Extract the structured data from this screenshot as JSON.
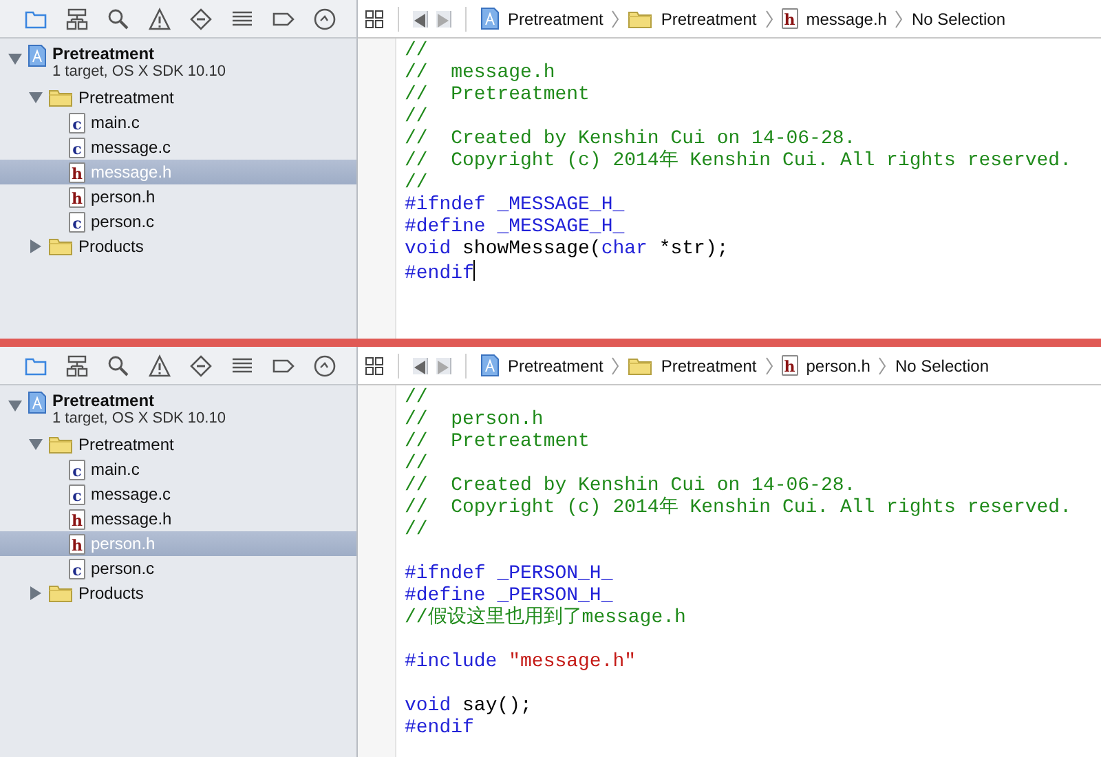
{
  "panes": [
    {
      "navigator_tabs": [
        {
          "kind": "folder",
          "selected": true
        },
        {
          "kind": "hierarchy",
          "selected": false
        },
        {
          "kind": "search",
          "selected": false
        },
        {
          "kind": "warning",
          "selected": false
        },
        {
          "kind": "breakpoint",
          "selected": false
        },
        {
          "kind": "list",
          "selected": false
        },
        {
          "kind": "tag",
          "selected": false
        },
        {
          "kind": "clock",
          "selected": false
        }
      ],
      "navigator": {
        "name": "Pretreatment",
        "subtitle": "1 target, OS X SDK 10.10",
        "expanded": true,
        "selected": false,
        "children": [
          {
            "kind": "folder",
            "name": "Pretreatment",
            "expanded": true,
            "selected": false,
            "children": [
              {
                "kind": "source",
                "badge": "c",
                "name": "main.c",
                "selected": false
              },
              {
                "kind": "source",
                "badge": "c",
                "name": "message.c",
                "selected": false
              },
              {
                "kind": "header",
                "badge": "h",
                "name": "message.h",
                "selected": true
              },
              {
                "kind": "header",
                "badge": "h",
                "name": "person.h",
                "selected": false
              },
              {
                "kind": "source",
                "badge": "c",
                "name": "person.c",
                "selected": false
              }
            ]
          },
          {
            "kind": "folder",
            "name": "Products",
            "expanded": false,
            "selected": false
          }
        ]
      },
      "jump_bar": [
        {
          "kind": "project",
          "label": "Pretreatment"
        },
        {
          "kind": "folder",
          "label": "Pretreatment"
        },
        {
          "kind": "header",
          "badge": "h",
          "label": "message.h"
        },
        {
          "kind": "plain",
          "label": "No Selection"
        }
      ],
      "code": [
        {
          "cursor": false,
          "tokens": [
            {
              "kind": "comment",
              "text": "//"
            }
          ]
        },
        {
          "cursor": false,
          "tokens": [
            {
              "kind": "comment",
              "text": "//  message.h"
            }
          ]
        },
        {
          "cursor": false,
          "tokens": [
            {
              "kind": "comment",
              "text": "//  Pretreatment"
            }
          ]
        },
        {
          "cursor": false,
          "tokens": [
            {
              "kind": "comment",
              "text": "//"
            }
          ]
        },
        {
          "cursor": false,
          "tokens": [
            {
              "kind": "comment",
              "text": "//  Created by Kenshin Cui on 14-06-28."
            }
          ]
        },
        {
          "cursor": false,
          "tokens": [
            {
              "kind": "comment",
              "text": "//  Copyright (c) 2014年 Kenshin Cui. All rights reserved."
            }
          ]
        },
        {
          "cursor": false,
          "tokens": [
            {
              "kind": "comment",
              "text": "//"
            }
          ]
        },
        {
          "cursor": false,
          "tokens": [
            {
              "kind": "keyword",
              "text": "#ifndef _MESSAGE_H_"
            }
          ]
        },
        {
          "cursor": false,
          "tokens": [
            {
              "kind": "keyword",
              "text": "#define _MESSAGE_H_"
            }
          ]
        },
        {
          "cursor": false,
          "tokens": [
            {
              "kind": "keyword",
              "text": "void"
            },
            {
              "kind": "plain",
              "text": " showMessage("
            },
            {
              "kind": "keyword",
              "text": "char"
            },
            {
              "kind": "plain",
              "text": " *str);"
            }
          ]
        },
        {
          "cursor": true,
          "tokens": [
            {
              "kind": "keyword",
              "text": "#endif"
            }
          ]
        }
      ]
    },
    {
      "navigator_tabs": [
        {
          "kind": "folder",
          "selected": true
        },
        {
          "kind": "hierarchy",
          "selected": false
        },
        {
          "kind": "search",
          "selected": false
        },
        {
          "kind": "warning",
          "selected": false
        },
        {
          "kind": "breakpoint",
          "selected": false
        },
        {
          "kind": "list",
          "selected": false
        },
        {
          "kind": "tag",
          "selected": false
        },
        {
          "kind": "clock",
          "selected": false
        }
      ],
      "navigator": {
        "name": "Pretreatment",
        "subtitle": "1 target, OS X SDK 10.10",
        "expanded": true,
        "selected": false,
        "children": [
          {
            "kind": "folder",
            "name": "Pretreatment",
            "expanded": true,
            "selected": false,
            "children": [
              {
                "kind": "source",
                "badge": "c",
                "name": "main.c",
                "selected": false
              },
              {
                "kind": "source",
                "badge": "c",
                "name": "message.c",
                "selected": false
              },
              {
                "kind": "header",
                "badge": "h",
                "name": "message.h",
                "selected": false
              },
              {
                "kind": "header",
                "badge": "h",
                "name": "person.h",
                "selected": true
              },
              {
                "kind": "source",
                "badge": "c",
                "name": "person.c",
                "selected": false
              }
            ]
          },
          {
            "kind": "folder",
            "name": "Products",
            "expanded": false,
            "selected": false
          }
        ]
      },
      "jump_bar": [
        {
          "kind": "project",
          "label": "Pretreatment"
        },
        {
          "kind": "folder",
          "label": "Pretreatment"
        },
        {
          "kind": "header",
          "badge": "h",
          "label": "person.h"
        },
        {
          "kind": "plain",
          "label": "No Selection"
        }
      ],
      "code": [
        {
          "cursor": false,
          "tokens": [
            {
              "kind": "comment",
              "text": "//"
            }
          ]
        },
        {
          "cursor": false,
          "tokens": [
            {
              "kind": "comment",
              "text": "//  person.h"
            }
          ]
        },
        {
          "cursor": false,
          "tokens": [
            {
              "kind": "comment",
              "text": "//  Pretreatment"
            }
          ]
        },
        {
          "cursor": false,
          "tokens": [
            {
              "kind": "comment",
              "text": "//"
            }
          ]
        },
        {
          "cursor": false,
          "tokens": [
            {
              "kind": "comment",
              "text": "//  Created by Kenshin Cui on 14-06-28."
            }
          ]
        },
        {
          "cursor": false,
          "tokens": [
            {
              "kind": "comment",
              "text": "//  Copyright (c) 2014年 Kenshin Cui. All rights reserved."
            }
          ]
        },
        {
          "cursor": false,
          "tokens": [
            {
              "kind": "comment",
              "text": "//"
            }
          ]
        },
        {
          "cursor": false
        },
        {
          "cursor": false,
          "tokens": [
            {
              "kind": "keyword",
              "text": "#ifndef _PERSON_H_"
            }
          ]
        },
        {
          "cursor": false,
          "tokens": [
            {
              "kind": "keyword",
              "text": "#define _PERSON_H_"
            }
          ]
        },
        {
          "cursor": false,
          "tokens": [
            {
              "kind": "comment",
              "text": "//假设这里也用到了message.h"
            }
          ]
        },
        {
          "cursor": false
        },
        {
          "cursor": false,
          "tokens": [
            {
              "kind": "keyword",
              "text": "#include "
            },
            {
              "kind": "string",
              "text": "\"message.h\""
            }
          ]
        },
        {
          "cursor": false
        },
        {
          "cursor": false,
          "tokens": [
            {
              "kind": "keyword",
              "text": "void"
            },
            {
              "kind": "plain",
              "text": " say();"
            }
          ]
        },
        {
          "cursor": false,
          "tokens": [
            {
              "kind": "keyword",
              "text": "#endif"
            }
          ]
        }
      ]
    }
  ]
}
